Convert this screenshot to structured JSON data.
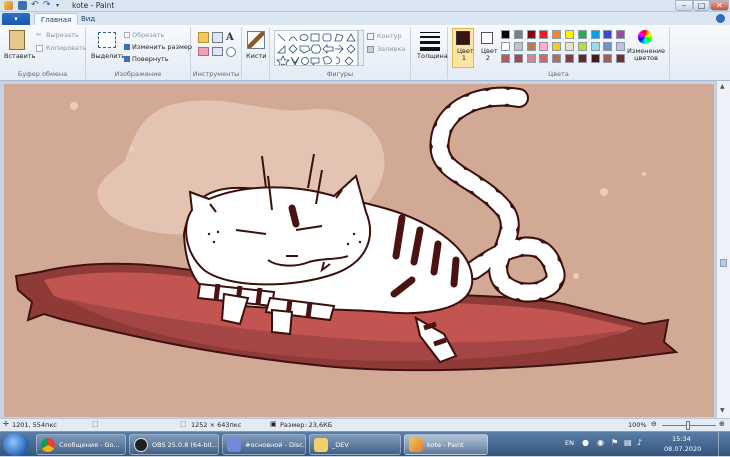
{
  "window": {
    "title": "kote - Paint"
  },
  "tabs": {
    "file": "▾",
    "home": "Главная",
    "view": "Вид"
  },
  "clipboard": {
    "paste": "Вставить",
    "cut": "Вырезать",
    "copy": "Копировать",
    "label": "Буфер обмена"
  },
  "image": {
    "select": "Выделить",
    "crop": "Обрезать",
    "resize": "Изменить размер",
    "rotate": "Повернуть",
    "label": "Изображение"
  },
  "tools": {
    "label": "Инструменты",
    "text_icon": "A"
  },
  "brushes": {
    "label": "Кисти"
  },
  "shapes": {
    "outline": "Контур",
    "fill": "Заливка",
    "label": "Фигуры"
  },
  "size": {
    "label": "Толщина"
  },
  "colors": {
    "color1": "Цвет 1",
    "color2": "Цвет 2",
    "edit": "Изменение цветов",
    "label": "Цвета",
    "color1_value": "#3a1410",
    "color2_value": "#ffffff",
    "palette": [
      "#000000",
      "#7f7f7f",
      "#880015",
      "#ed1c24",
      "#ff7f27",
      "#fff200",
      "#22b14c",
      "#00a2e8",
      "#3f48cc",
      "#a349a4",
      "#ffffff",
      "#c3c3c3",
      "#b97a57",
      "#ffaec9",
      "#ffc90e",
      "#efe4b0",
      "#b5e61d",
      "#99d9ea",
      "#7092be",
      "#c8bfe7",
      "#b5585a",
      "#a14a4c",
      "#d48a8c",
      "#c96b6d",
      "#b46a5f",
      "#8c3a3a",
      "#6b2424",
      "#4a1818",
      "#a35b52",
      "#7a2d2d"
    ]
  },
  "status": {
    "cursor": "1201, 554пкс",
    "dimensions": "1252 × 643пкс",
    "file_size": "Размер: 23,6КБ",
    "zoom": "100%"
  },
  "taskbar": {
    "items": [
      "Сообщения - Go...",
      "OBS 25.0.8 (64-bit...",
      "#основной - Disc...",
      "_DEV",
      "kote - Paint"
    ],
    "lang": "EN",
    "time": "15:34",
    "date": "08.07.2020"
  }
}
